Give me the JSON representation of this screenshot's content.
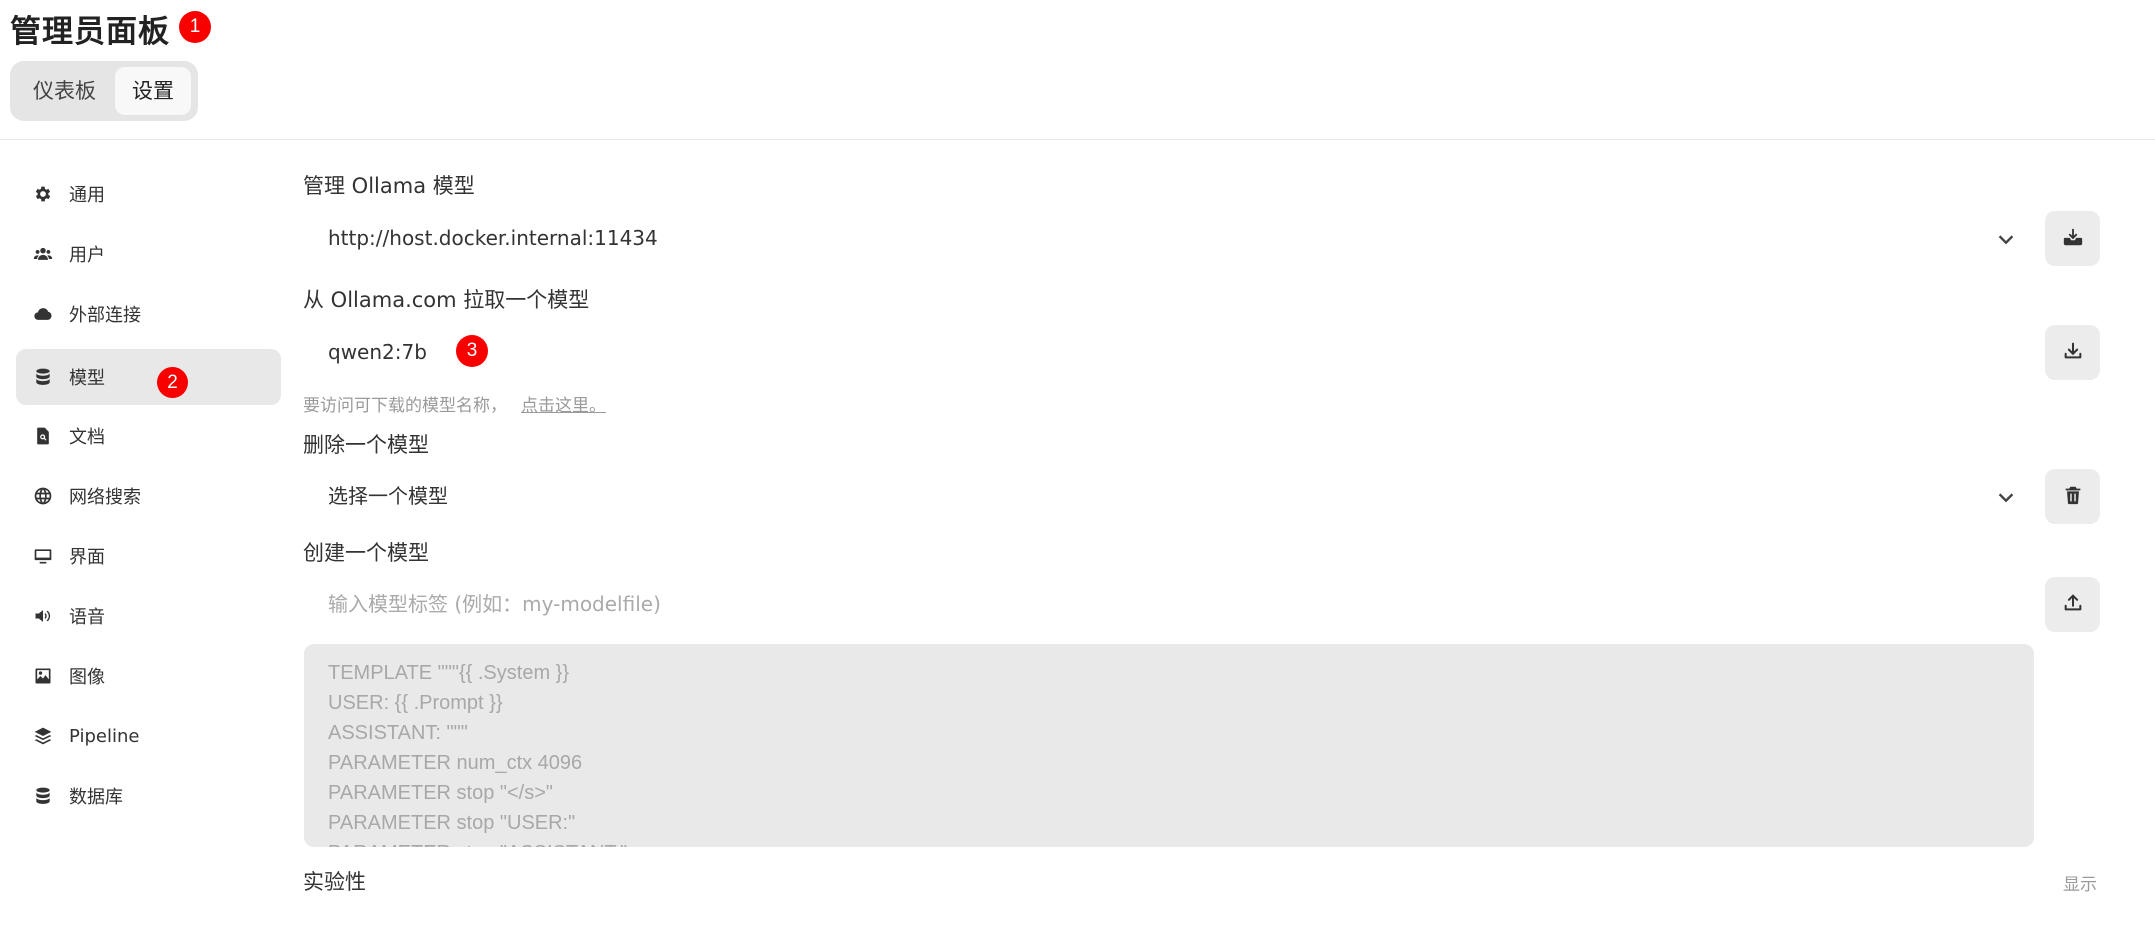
{
  "header": {
    "title": "管理员面板",
    "badges": [
      "1",
      "2",
      "3"
    ],
    "tabs": [
      {
        "label": "仪表板",
        "active": false
      },
      {
        "label": "设置",
        "active": true
      }
    ]
  },
  "sidebar": {
    "items": [
      {
        "label": "通用",
        "icon": "gear-icon"
      },
      {
        "label": "用户",
        "icon": "users-icon"
      },
      {
        "label": "外部连接",
        "icon": "cloud-icon"
      },
      {
        "label": "模型",
        "icon": "database-icon",
        "active": true
      },
      {
        "label": "文档",
        "icon": "document-search-icon"
      },
      {
        "label": "网络搜索",
        "icon": "globe-icon"
      },
      {
        "label": "界面",
        "icon": "monitor-icon"
      },
      {
        "label": "语音",
        "icon": "speaker-icon"
      },
      {
        "label": "图像",
        "icon": "image-icon"
      },
      {
        "label": "Pipeline",
        "icon": "layers-icon"
      },
      {
        "label": "数据库",
        "icon": "database-icon"
      }
    ]
  },
  "main": {
    "manage_title": "管理 Ollama 模型",
    "ollama_url": "http://host.docker.internal:11434",
    "pull_title": "从 Ollama.com 拉取一个模型",
    "pull_value": "qwen2:7b",
    "pull_hint": "要访问可下载的模型名称，",
    "pull_hint_link": "点击这里。",
    "delete_title": "删除一个模型",
    "delete_select": "选择一个模型",
    "create_title": "创建一个模型",
    "create_placeholder": "输入模型标签 (例如：my-modelfile)",
    "modelfile_lines": [
      "TEMPLATE \"\"\"{{ .System }}",
      "USER: {{ .Prompt }}",
      "ASSISTANT: \"\"\"",
      "PARAMETER num_ctx 4096",
      "PARAMETER stop \"</s>\"",
      "PARAMETER stop \"USER:\"",
      "PARAMETER stop \"ASSISTANT:\""
    ],
    "experimental_title": "实验性",
    "show_label": "显示"
  },
  "colors": {
    "badge": "#f80000",
    "active_bg": "#e8e8e8",
    "button_bg": "#ececec"
  }
}
